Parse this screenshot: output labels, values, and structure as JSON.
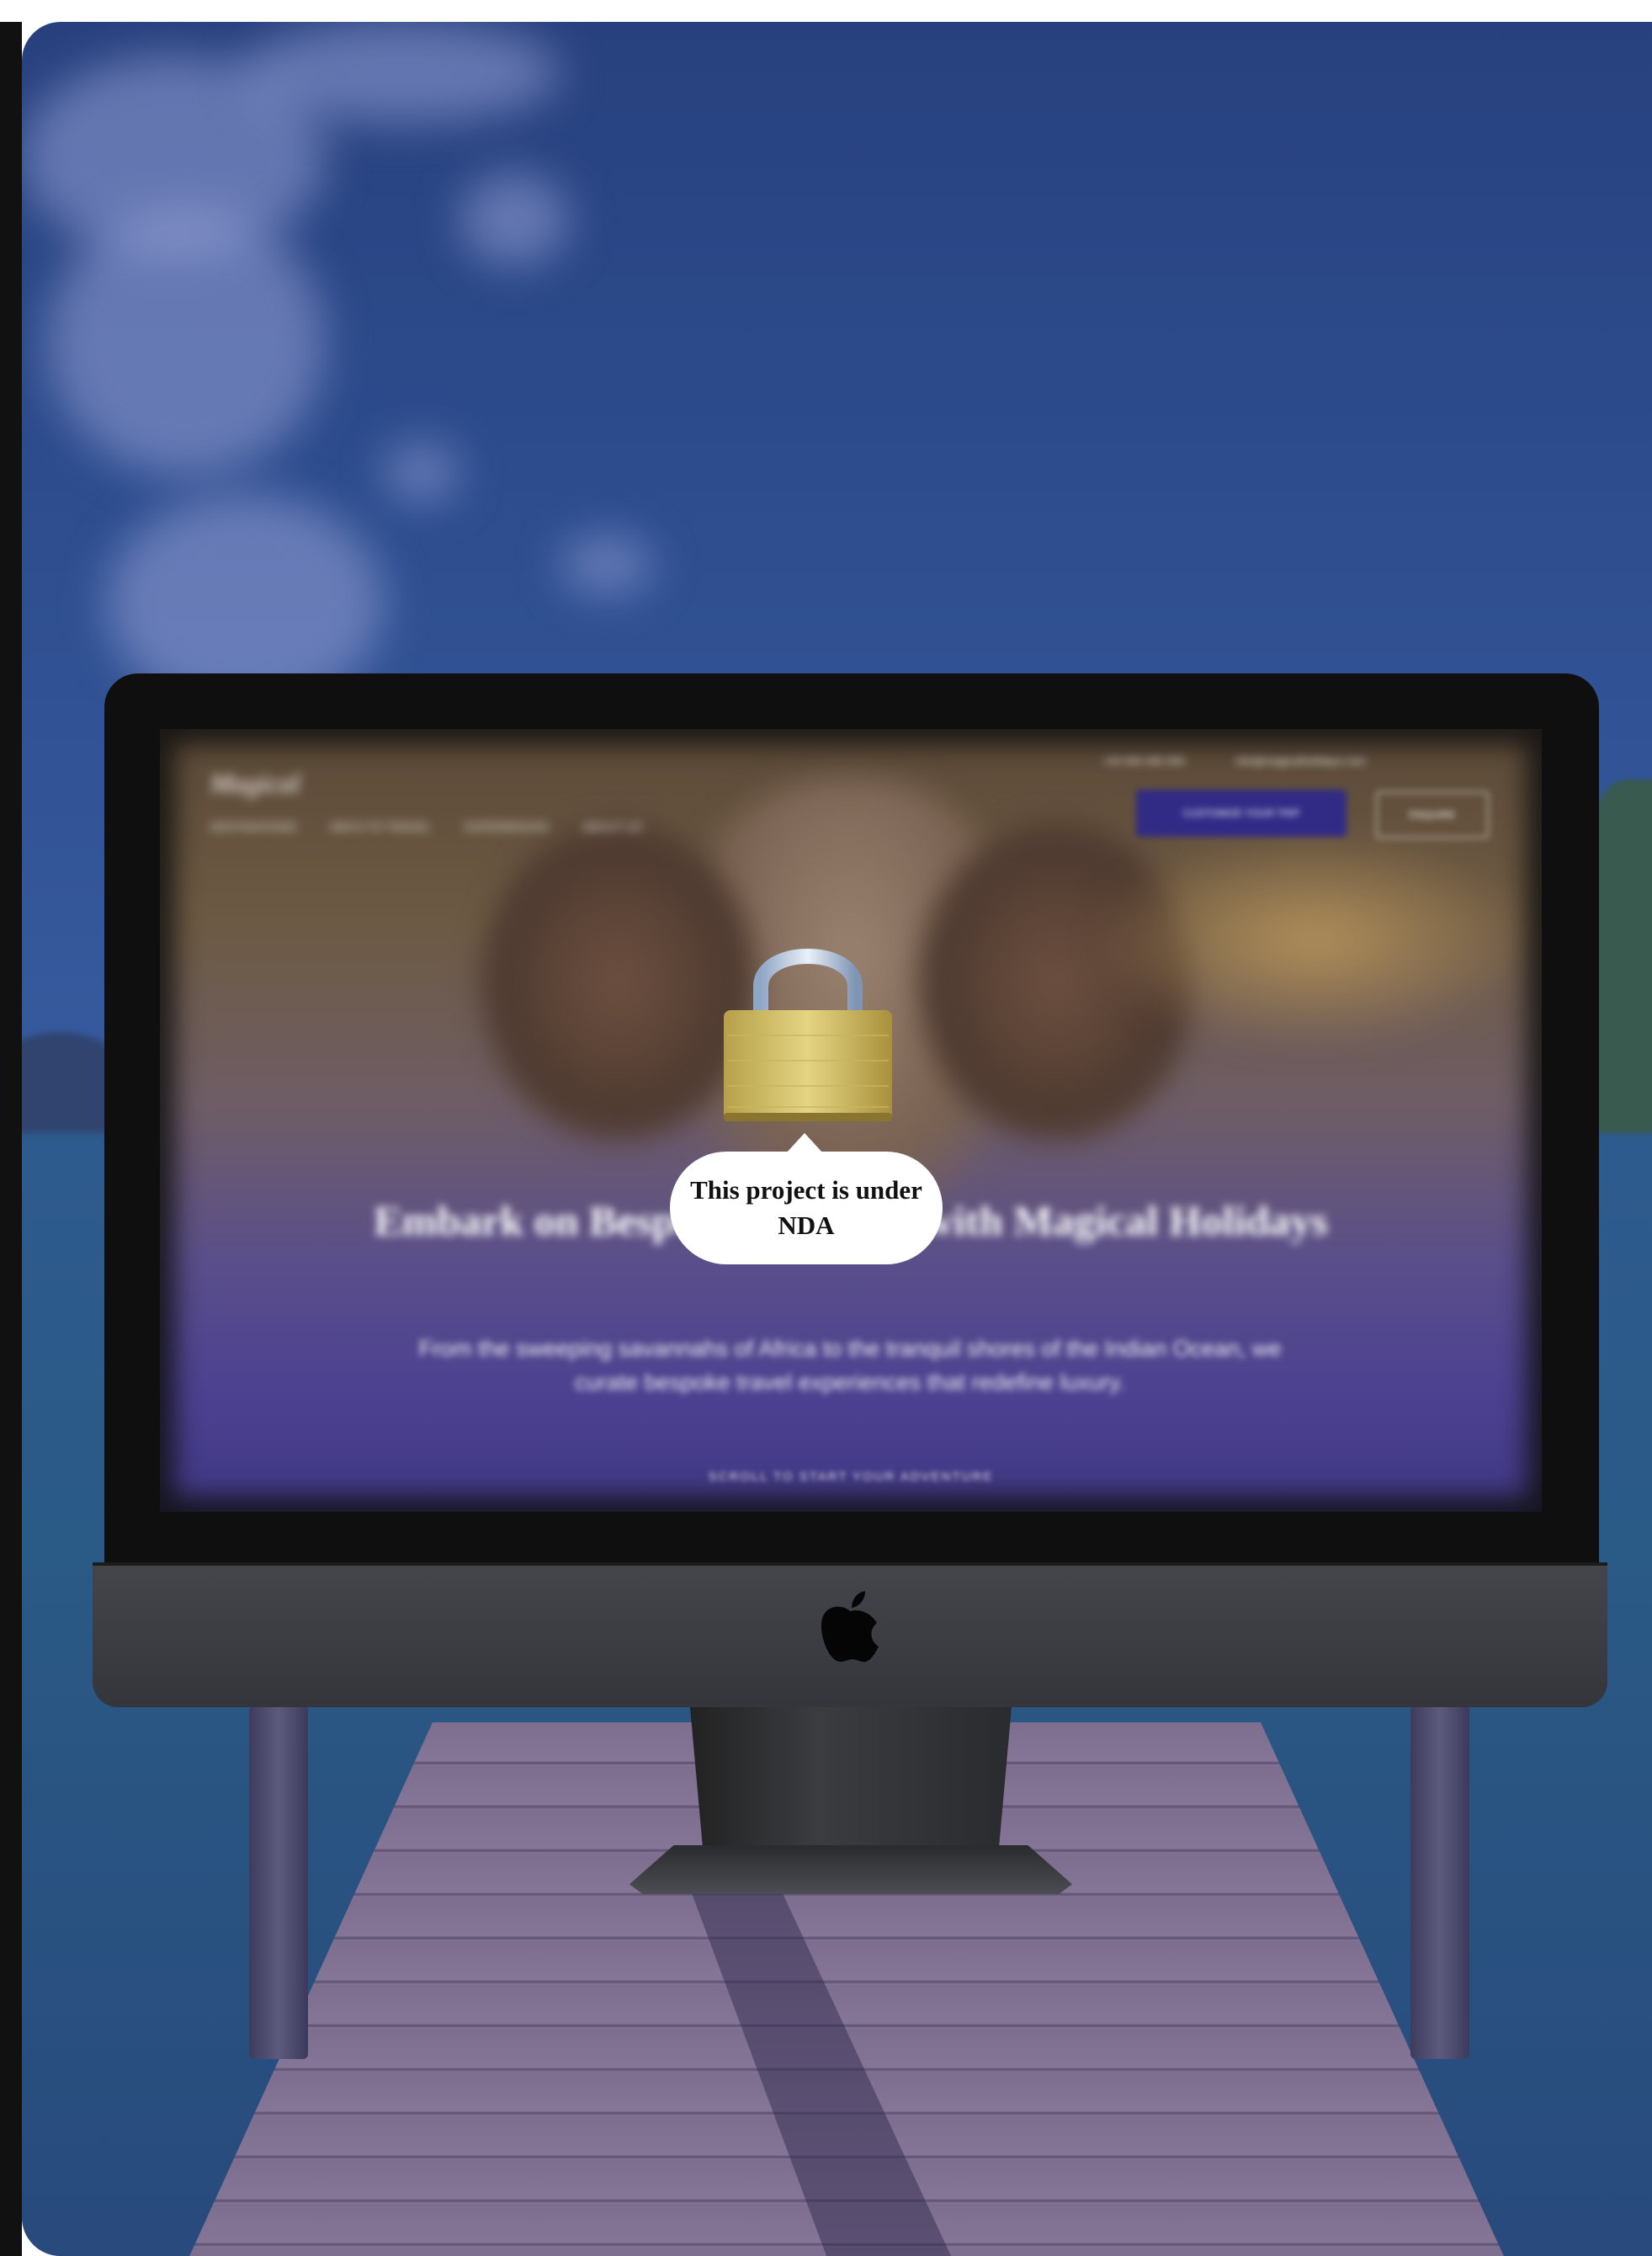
{
  "overlay": {
    "lock_icon": "padlock-icon",
    "nda_text": "This project is under NDA"
  },
  "device": {
    "type": "imac",
    "logo_icon": "apple-logo-icon"
  },
  "website_preview": {
    "logo": "Magical",
    "nav_items": [
      "DESTINATIONS",
      "WAYS TO TRAVEL",
      "EXPERIENCES",
      "ABOUT US"
    ],
    "contact_phone": "+44 000 000 000",
    "contact_email": "info@magicalholidays.com",
    "cta_primary": "CUSTOMIZE YOUR TRIP",
    "cta_secondary": "ENQUIRE",
    "headline": "Embark on Bespoke Journeys with Magical Holidays",
    "subheadline": "From the sweeping savannahs of Africa to the tranquil shores of the Indian Ocean, we curate bespoke travel experiences that redefine luxury.",
    "scroll_hint": "SCROLL TO START YOUR ADVENTURE"
  },
  "colors": {
    "overlay_tint": "#3a4a8c",
    "cta_primary_bg": "#312b86",
    "bubble_bg": "#ffffff"
  }
}
